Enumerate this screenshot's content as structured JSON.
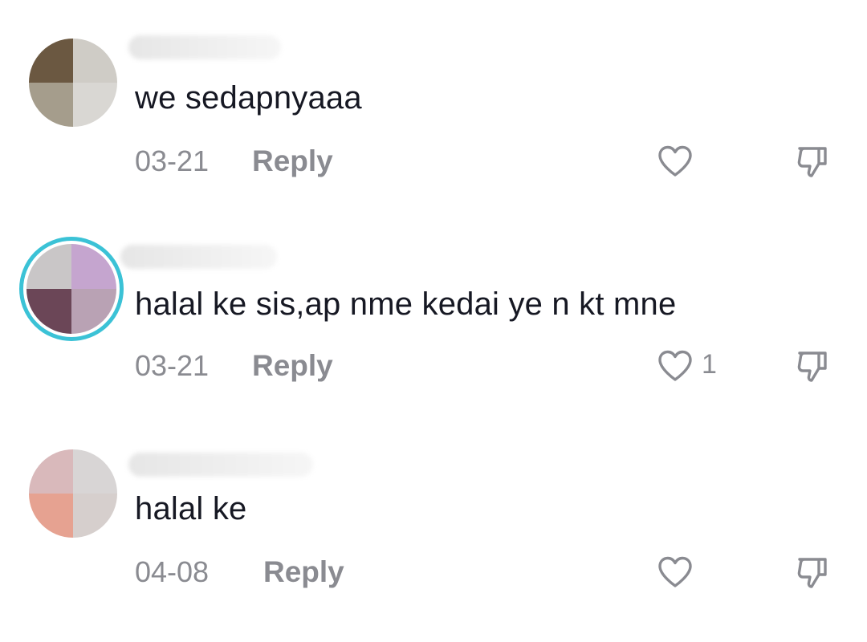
{
  "comments": [
    {
      "text": "we sedapnyaaa",
      "date": "03-21",
      "reply_label": "Reply",
      "like_count": "",
      "avatar_colors": [
        "#6b5841",
        "#cfccc6",
        "#a59d8c",
        "#d9d7d3"
      ],
      "avatar_ring": false
    },
    {
      "text": "halal ke sis,ap nme kedai ye n kt mne",
      "date": "03-21",
      "reply_label": "Reply",
      "like_count": "1",
      "avatar_colors": [
        "#c9c6c7",
        "#c5a5cf",
        "#6b4657",
        "#b9a2b4"
      ],
      "avatar_ring": true,
      "ring_color": "#3bc2d6"
    },
    {
      "text": "halal ke",
      "date": "04-08",
      "reply_label": "Reply",
      "like_count": "",
      "avatar_colors": [
        "#d9b9bb",
        "#d8d5d5",
        "#e6a291",
        "#d6cfcd"
      ],
      "avatar_ring": false
    }
  ],
  "icons": {
    "like": "heart-outline-icon",
    "dislike": "thumbs-down-icon"
  },
  "colors": {
    "text": "#161823",
    "secondary": "#8a8b91",
    "background": "#ffffff"
  }
}
